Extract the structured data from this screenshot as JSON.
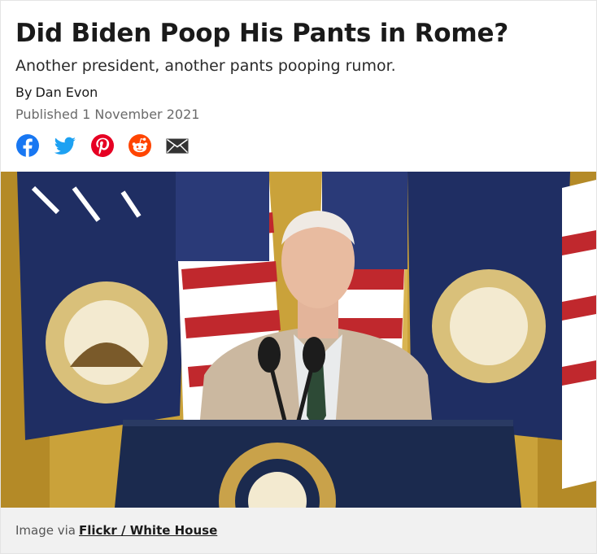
{
  "article": {
    "title": "Did Biden Poop His Pants in Rome?",
    "subtitle": "Another president, another pants pooping rumor.",
    "byline_prefix": "By",
    "author": "Dan Evon",
    "published": "Published 1 November 2021"
  },
  "share": {
    "icons": [
      "facebook-icon",
      "twitter-icon",
      "pinterest-icon",
      "reddit-icon",
      "email-icon"
    ]
  },
  "image": {
    "caption_prefix": "Image via",
    "caption_link": "Flickr / White House"
  },
  "colors": {
    "facebook": "#1877f2",
    "twitter": "#1da1f2",
    "pinterest": "#e60023",
    "reddit": "#ff4500",
    "email": "#333333"
  }
}
